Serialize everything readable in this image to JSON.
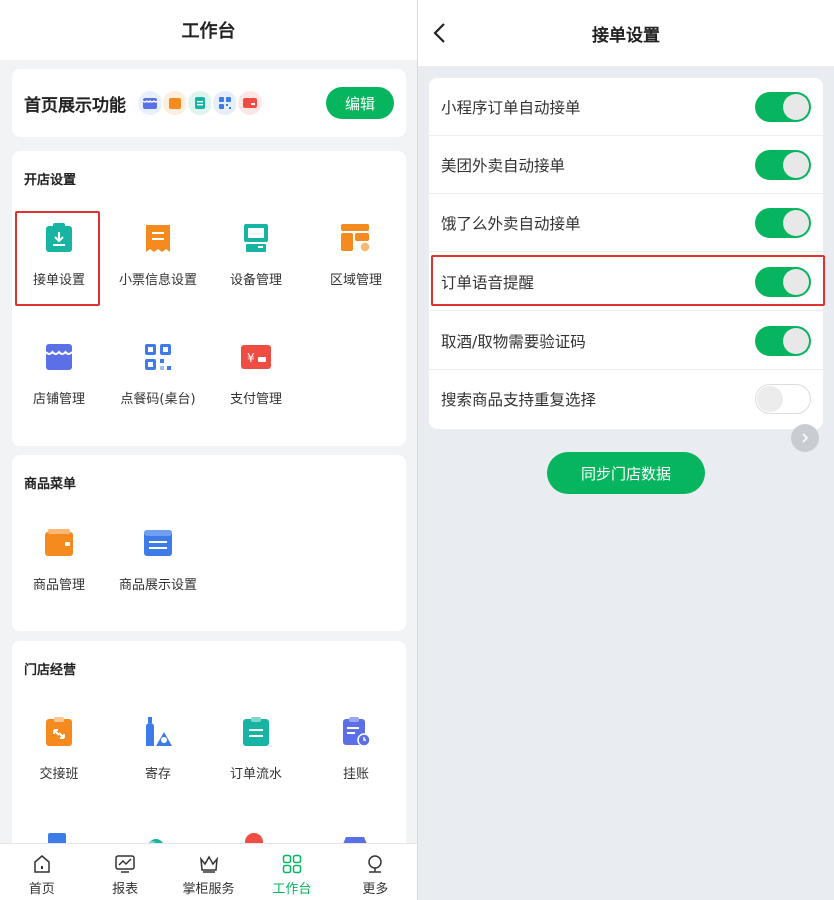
{
  "left": {
    "header_title": "工作台",
    "home_card": {
      "title": "首页展示功能",
      "edit_label": "编辑"
    },
    "sections": {
      "open_store": {
        "title": "开店设置",
        "items": [
          "接单设置",
          "小票信息设置",
          "设备管理",
          "区域管理",
          "店铺管理",
          "点餐码(桌台)",
          "支付管理"
        ]
      },
      "menu": {
        "title": "商品菜单",
        "items": [
          "商品管理",
          "商品展示设置"
        ]
      },
      "ops": {
        "title": "门店经营",
        "items": [
          "交接班",
          "寄存",
          "订单流水",
          "挂账"
        ]
      }
    },
    "tabbar": [
      "首页",
      "报表",
      "掌柜服务",
      "工作台",
      "更多"
    ],
    "active_tab": "工作台"
  },
  "right": {
    "header_title": "接单设置",
    "settings": [
      {
        "label": "小程序订单自动接单",
        "on": true
      },
      {
        "label": "美团外卖自动接单",
        "on": true
      },
      {
        "label": "饿了么外卖自动接单",
        "on": true
      },
      {
        "label": "订单语音提醒",
        "on": true
      },
      {
        "label": "取酒/取物需要验证码",
        "on": true
      },
      {
        "label": "搜索商品支持重复选择",
        "on": false
      }
    ],
    "sync_button": "同步门店数据"
  },
  "colors": {
    "brand_green": "#07b55e",
    "highlight_red": "#e0322e"
  }
}
